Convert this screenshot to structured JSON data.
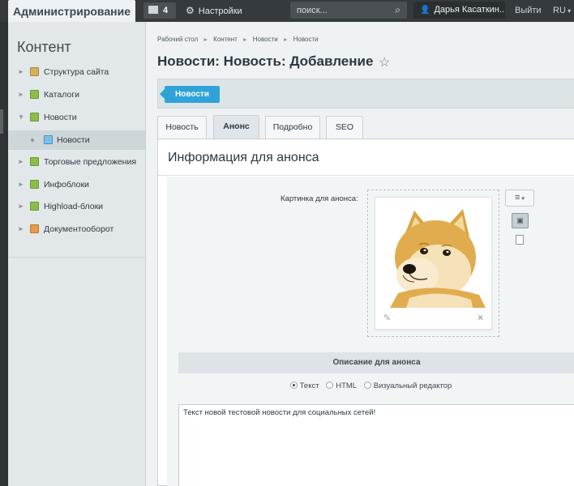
{
  "topbar": {
    "admin_tab": "Администрирование",
    "notifications_count": "4",
    "settings_label": "Настройки",
    "search_placeholder": "поиск...",
    "user_name": "Дарья Касаткин...",
    "logout": "Выйти",
    "lang": "RU"
  },
  "sidebar": {
    "title": "Контент",
    "items": [
      {
        "label": "Структура сайта",
        "icon": "site-structure-icon"
      },
      {
        "label": "Каталоги",
        "icon": "catalog-icon"
      },
      {
        "label": "Новости",
        "icon": "news-folder-icon"
      },
      {
        "label": "Новости",
        "icon": "news-list-icon",
        "active": true
      },
      {
        "label": "Торговые предложения",
        "icon": "offers-icon"
      },
      {
        "label": "Инфоблоки",
        "icon": "infoblocks-icon"
      },
      {
        "label": "Highload-блоки",
        "icon": "highload-icon"
      },
      {
        "label": "Документооборот",
        "icon": "workflow-icon"
      }
    ]
  },
  "breadcrumb": [
    "Рабочий стол",
    "Контент",
    "Новости",
    "Новости"
  ],
  "page": {
    "title": "Новости: Новость: Добавление",
    "context_button": "Новости"
  },
  "tabs": [
    {
      "label": "Новость"
    },
    {
      "label": "Анонс",
      "active": true
    },
    {
      "label": "Подробно"
    },
    {
      "label": "SEO"
    }
  ],
  "form": {
    "section_title": "Информация для анонса",
    "image_label": "Картинка для анонса:",
    "description_header": "Описание для анонса",
    "radio_options": [
      "Текст",
      "HTML",
      "Визуальный редактор"
    ],
    "selected_radio": "Текст",
    "description_text": "Текст новой тестовой новости для социальных сетей!"
  },
  "colors": {
    "topbar_bg": "#343a3e",
    "accent_blue": "#2fa3d8",
    "sidebar_bg": "#e2e8ea"
  }
}
